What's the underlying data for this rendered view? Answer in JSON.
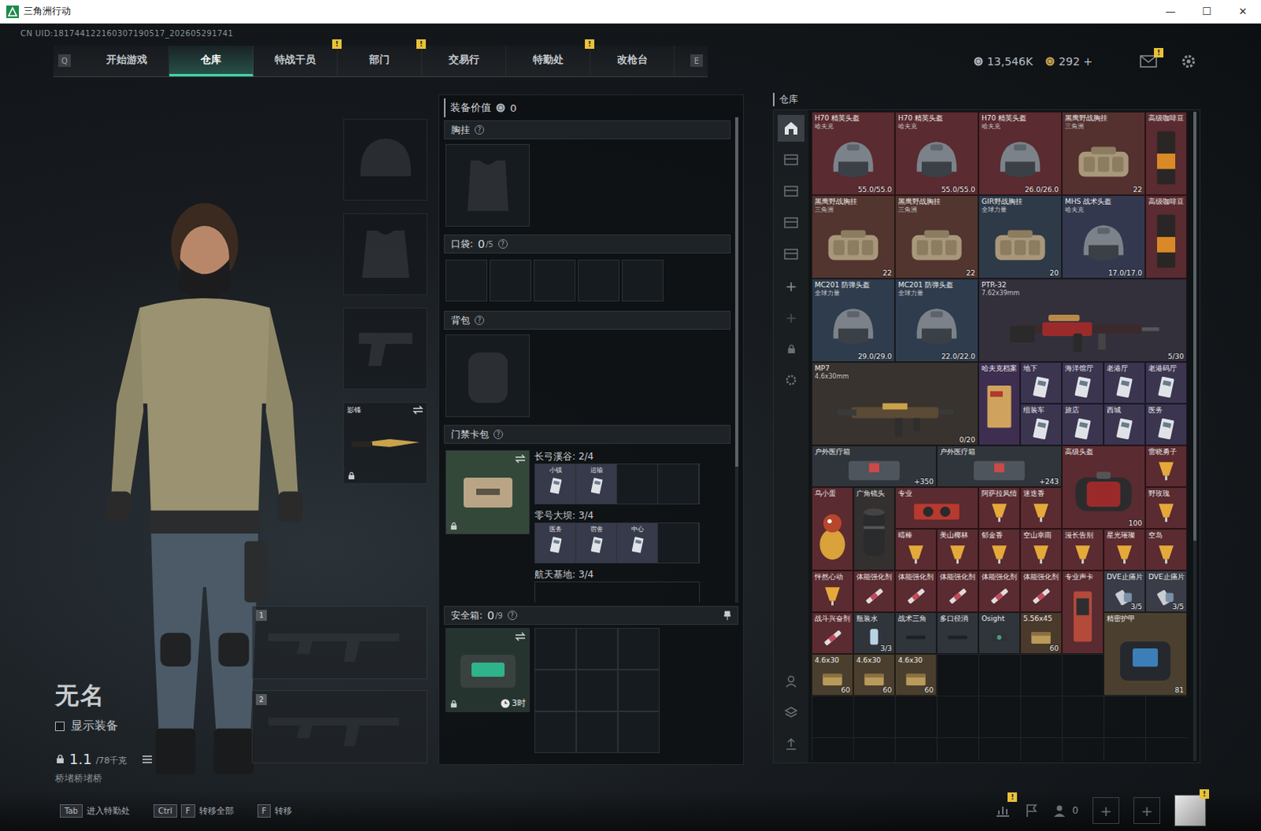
{
  "window": {
    "title": "三角洲行动",
    "controls": [
      "—",
      "☐",
      "✕"
    ]
  },
  "account": {
    "uid": "CN UID:181744122160307190517_202605291741"
  },
  "nav": {
    "prev_key": "Q",
    "next_key": "E",
    "tabs": [
      {
        "label": "开始游戏",
        "selected": false,
        "badge": ""
      },
      {
        "label": "仓库",
        "selected": true,
        "badge": ""
      },
      {
        "label": "特战干员",
        "selected": false,
        "badge": "!"
      },
      {
        "label": "部门",
        "selected": false,
        "badge": "!"
      },
      {
        "label": "交易行",
        "selected": false,
        "badge": ""
      },
      {
        "label": "特勤处",
        "selected": false,
        "badge": "!"
      },
      {
        "label": "改枪台",
        "selected": false,
        "badge": ""
      }
    ]
  },
  "currency": {
    "coins": "13,546K",
    "tickets": "292",
    "add": "+",
    "mail_badge": "!"
  },
  "character": {
    "name": "无名",
    "show_equipment": {
      "label": "显示装备",
      "checked": false
    },
    "weight": "1.1",
    "capacity": "/78千克",
    "subtitle": "桥堵桥堵桥"
  },
  "equipment_slots": [
    {
      "kind": "helmet",
      "filled": false,
      "label": "",
      "locked": false
    },
    {
      "kind": "armor",
      "filled": false,
      "label": "",
      "locked": false
    },
    {
      "kind": "pistol",
      "filled": false,
      "label": "",
      "locked": false
    },
    {
      "kind": "melee",
      "filled": true,
      "label": "影锋",
      "locked": true
    }
  ],
  "weapon_slots": [
    {
      "number": "1",
      "filled": false
    },
    {
      "number": "2",
      "filled": false
    }
  ],
  "loadout": {
    "value_label": "装备价值",
    "value": "0",
    "rig": {
      "title": "胸挂",
      "help": "?"
    },
    "pockets": {
      "title": "口袋:",
      "count": "0",
      "capacity": "/5",
      "help": "?",
      "slots": [
        {
          "filled": false
        },
        {
          "filled": false
        },
        {
          "filled": false
        },
        {
          "filled": false
        },
        {
          "filled": false
        }
      ]
    },
    "backpack": {
      "title": "背包",
      "help": "?"
    },
    "keycard_pack": {
      "title": "门禁卡包",
      "help": "?",
      "locked": true,
      "maps": [
        {
          "name": "长弓溪谷:",
          "count": "2/4",
          "slots": [
            {
              "filled": true,
              "label": "小镇"
            },
            {
              "filled": true,
              "label": "运输"
            },
            {
              "filled": false,
              "label": ""
            },
            {
              "filled": false,
              "label": ""
            }
          ]
        },
        {
          "name": "零号大坝:",
          "count": "3/4",
          "slots": [
            {
              "filled": true,
              "label": "医务"
            },
            {
              "filled": true,
              "label": "宿舍"
            },
            {
              "filled": true,
              "label": "中心"
            },
            {
              "filled": false,
              "label": ""
            }
          ]
        },
        {
          "name": "航天基地:",
          "count": "3/4",
          "slots": []
        }
      ]
    },
    "safe_box": {
      "title": "安全箱:",
      "count": "0",
      "capacity": "/9",
      "help": "?",
      "timer": "3时",
      "locked": true,
      "slots": [
        {
          "filled": false
        },
        {
          "filled": false
        },
        {
          "filled": false
        },
        {
          "filled": false
        },
        {
          "filled": false
        },
        {
          "filled": false
        },
        {
          "filled": false
        },
        {
          "filled": false
        },
        {
          "filled": false
        }
      ]
    }
  },
  "warehouse": {
    "title": "仓库",
    "sidebar": {
      "tabs": [
        {
          "selected": true
        },
        {
          "selected": false
        },
        {
          "selected": false
        },
        {
          "selected": false
        },
        {
          "selected": false
        }
      ],
      "add": "+",
      "add_more": "+"
    },
    "items": [
      {
        "name": "H70 精英头盔",
        "brand": "哈夫克",
        "value": "55.0/55.0",
        "kind": "helmet",
        "color": "#5a2b30"
      },
      {
        "name": "H70 精英头盔",
        "brand": "哈夫克",
        "value": "55.0/55.0",
        "kind": "helmet",
        "color": "#5a2b30"
      },
      {
        "name": "H70 精英头盔",
        "brand": "哈夫克",
        "value": "26.0/26.0",
        "kind": "helmet",
        "color": "#5a2b30"
      },
      {
        "name": "黑鹰野战胸挂",
        "brand": "三角洲",
        "value": "22",
        "kind": "rig",
        "color": "#54302f"
      },
      {
        "name": "高级咖啡豆",
        "brand": "",
        "value": "",
        "kind": "tall",
        "color": "#5a2b30"
      },
      {
        "name": "黑鹰野战胸挂",
        "brand": "三角洲",
        "value": "22",
        "kind": "rig",
        "color": "#52352f"
      },
      {
        "name": "黑鹰野战胸挂",
        "brand": "三角洲",
        "value": "22",
        "kind": "rig",
        "color": "#52352f"
      },
      {
        "name": "GIR野战胸挂",
        "brand": "全球力量",
        "value": "20",
        "kind": "rig",
        "color": "#2e3a48"
      },
      {
        "name": "MHS 战术头盔",
        "brand": "哈夫克",
        "value": "17.0/17.0",
        "kind": "helmet",
        "color": "#34384e"
      },
      {
        "name": "高级咖啡豆",
        "brand": "",
        "value": "",
        "kind": "tall",
        "color": "#5a2b30"
      },
      {
        "name": "MC201 防弹头盔",
        "brand": "全球力量",
        "value": "29.0/29.0",
        "kind": "helmet",
        "color": "#2f3c4d"
      },
      {
        "name": "MC201 防弹头盔",
        "brand": "全球力量",
        "value": "22.0/22.0",
        "kind": "helmet",
        "color": "#2f3c4d"
      },
      {
        "name": "PTR-32",
        "brand": "7.62x39mm",
        "value": "5/30",
        "kind": "rifle",
        "color": "#33303c"
      },
      {
        "name": "MP7",
        "brand": "4.6x30mm",
        "value": "0/20",
        "kind": "smg",
        "color": "#38332e"
      },
      {
        "name": "哈夫克档案",
        "brand": "",
        "value": "",
        "kind": "document",
        "color": "#3e2f50"
      },
      {
        "name": "地下",
        "brand": "",
        "value": "",
        "kind": "keycard",
        "color": "#3b3550"
      },
      {
        "name": "海洋馆厅",
        "brand": "",
        "value": "",
        "kind": "keycard",
        "color": "#3b3550"
      },
      {
        "name": "老港厅",
        "brand": "",
        "value": "",
        "kind": "keycard",
        "color": "#3b3550"
      },
      {
        "name": "老港码厅",
        "brand": "",
        "value": "",
        "kind": "keycard",
        "color": "#3b3550"
      },
      {
        "name": "组装车",
        "brand": "",
        "value": "",
        "kind": "keycard",
        "color": "#3b3550"
      },
      {
        "name": "旅店",
        "brand": "",
        "value": "",
        "kind": "keycard",
        "color": "#3b3550"
      },
      {
        "name": "西城",
        "brand": "",
        "value": "",
        "kind": "keycard",
        "color": "#3b3550"
      },
      {
        "name": "医务",
        "brand": "",
        "value": "",
        "kind": "keycard",
        "color": "#3b3550"
      },
      {
        "name": "户外医疗箱",
        "brand": "",
        "value": "+350",
        "kind": "medkit",
        "color": "#30353b"
      },
      {
        "name": "户外医疗箱",
        "brand": "",
        "value": "+243",
        "kind": "medkit",
        "color": "#30353b"
      },
      {
        "name": "高级头盔",
        "brand": "",
        "value": "100",
        "kind": "case",
        "color": "#5a2b30"
      },
      {
        "name": "雷晓勇子",
        "brand": "",
        "value": "",
        "kind": "drink",
        "color": "#5a2b30"
      },
      {
        "name": "乌小蛋",
        "brand": "",
        "value": "",
        "kind": "figure",
        "color": "#5a2b30"
      },
      {
        "name": "广角镜头",
        "brand": "",
        "value": "",
        "kind": "lens",
        "color": "#33302f"
      },
      {
        "name": "专业",
        "brand": "",
        "value": "",
        "kind": "gpu",
        "color": "#5a2b30"
      },
      {
        "name": "阿萨拉风情",
        "brand": "",
        "value": "",
        "kind": "drink",
        "color": "#5a2b30"
      },
      {
        "name": "迷迭香",
        "brand": "",
        "value": "",
        "kind": "drink",
        "color": "#5a2b30"
      },
      {
        "name": "野玫瑰",
        "brand": "",
        "value": "",
        "kind": "drink",
        "color": "#5a2b30"
      },
      {
        "name": "晴棒",
        "brand": "",
        "value": "",
        "kind": "drink",
        "color": "#5a2b30"
      },
      {
        "name": "美山椰林",
        "brand": "",
        "value": "",
        "kind": "drink",
        "color": "#5a2b30"
      },
      {
        "name": "郁金香",
        "brand": "",
        "value": "",
        "kind": "drink",
        "color": "#5a2b30"
      },
      {
        "name": "空山幸雨",
        "brand": "",
        "value": "",
        "kind": "drink",
        "color": "#5a2b30"
      },
      {
        "name": "漫长告别",
        "brand": "",
        "value": "",
        "kind": "drink",
        "color": "#5a2b30"
      },
      {
        "name": "星光璀璨",
        "brand": "",
        "value": "",
        "kind": "drink",
        "color": "#5a2b30"
      },
      {
        "name": "空岛",
        "brand": "",
        "value": "",
        "kind": "drink",
        "color": "#5a2b30"
      },
      {
        "name": "怦然心动",
        "brand": "",
        "value": "",
        "kind": "drink",
        "color": "#5a2b30"
      },
      {
        "name": "体能强化剂",
        "brand": "",
        "value": "",
        "kind": "syringe",
        "color": "#5a2b30"
      },
      {
        "name": "体能强化剂",
        "brand": "",
        "value": "",
        "kind": "syringe",
        "color": "#5a2b30"
      },
      {
        "name": "体能强化剂",
        "brand": "",
        "value": "",
        "kind": "syringe",
        "color": "#5a2b30"
      },
      {
        "name": "体能强化剂",
        "brand": "",
        "value": "",
        "kind": "syringe",
        "color": "#5a2b30"
      },
      {
        "name": "体能强化剂",
        "brand": "",
        "value": "",
        "kind": "syringe",
        "color": "#5a2b30"
      },
      {
        "name": "专业声卡",
        "brand": "",
        "value": "",
        "kind": "soundcard",
        "color": "#5a2b30"
      },
      {
        "name": "DVE止痛片",
        "brand": "",
        "value": "3/5",
        "kind": "pill",
        "color": "#3a3d48"
      },
      {
        "name": "DVE止痛片",
        "brand": "",
        "value": "3/5",
        "kind": "pill",
        "color": "#3a3d48"
      },
      {
        "name": "战斗兴奋剂",
        "brand": "",
        "value": "",
        "kind": "syringe",
        "color": "#5a2b30"
      },
      {
        "name": "瓶装水",
        "brand": "",
        "value": "3/3",
        "kind": "bottle",
        "color": "#30353b"
      },
      {
        "name": "战术三角",
        "brand": "",
        "value": "",
        "kind": "tool",
        "color": "#30353b"
      },
      {
        "name": "多口径消",
        "brand": "",
        "value": "",
        "kind": "tool",
        "color": "#30353b"
      },
      {
        "name": "Osight",
        "brand": "",
        "value": "",
        "kind": "scope",
        "color": "#30353b"
      },
      {
        "name": "5.56x45",
        "brand": "",
        "value": "60",
        "kind": "ammo",
        "color": "#4a3a2c"
      },
      {
        "name": "精密护甲",
        "brand": "",
        "value": "81",
        "kind": "armor",
        "color": "#4b4030"
      },
      {
        "name": "4.6x30",
        "brand": "",
        "value": "60",
        "kind": "ammo",
        "color": "#4a3f2e"
      },
      {
        "name": "4.6x30",
        "brand": "",
        "value": "60",
        "kind": "ammo",
        "color": "#4a3f2e"
      },
      {
        "name": "4.6x30",
        "brand": "",
        "value": "60",
        "kind": "ammo",
        "color": "#4a3f2e"
      }
    ]
  },
  "bottom_bar": {
    "hints": [
      {
        "keys": [
          "Tab"
        ],
        "label": "进入特勤处"
      },
      {
        "keys": [
          "Ctrl",
          "F"
        ],
        "label": "转移全部"
      },
      {
        "keys": [
          "F"
        ],
        "label": "转移"
      }
    ],
    "stats_badge": "!",
    "squad_count": "0",
    "slot_add": [
      "+",
      "+"
    ],
    "avatar_badge": "!"
  }
}
